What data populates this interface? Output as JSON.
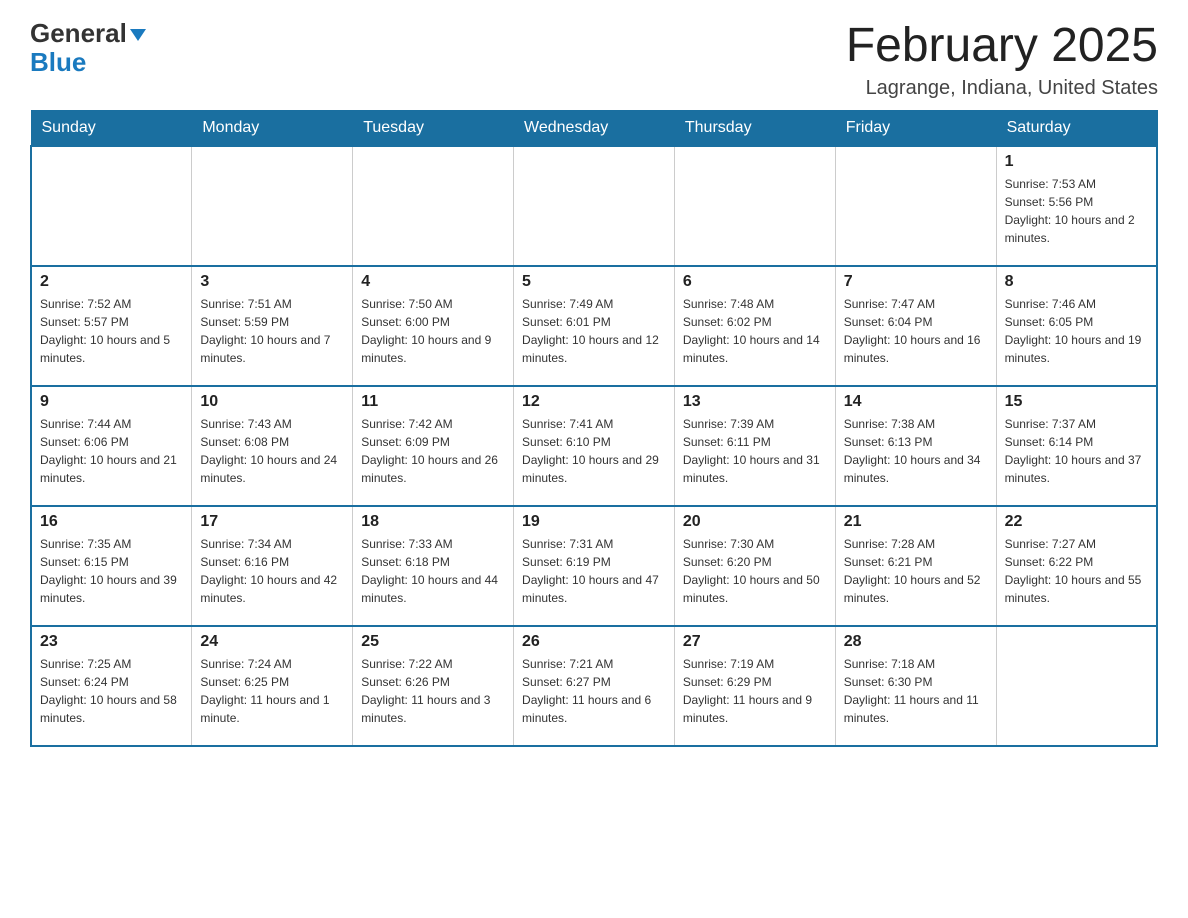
{
  "header": {
    "logo_general": "General",
    "logo_blue": "Blue",
    "month_title": "February 2025",
    "location": "Lagrange, Indiana, United States"
  },
  "days_of_week": [
    "Sunday",
    "Monday",
    "Tuesday",
    "Wednesday",
    "Thursday",
    "Friday",
    "Saturday"
  ],
  "weeks": [
    [
      {
        "day": "",
        "info": ""
      },
      {
        "day": "",
        "info": ""
      },
      {
        "day": "",
        "info": ""
      },
      {
        "day": "",
        "info": ""
      },
      {
        "day": "",
        "info": ""
      },
      {
        "day": "",
        "info": ""
      },
      {
        "day": "1",
        "info": "Sunrise: 7:53 AM\nSunset: 5:56 PM\nDaylight: 10 hours and 2 minutes."
      }
    ],
    [
      {
        "day": "2",
        "info": "Sunrise: 7:52 AM\nSunset: 5:57 PM\nDaylight: 10 hours and 5 minutes."
      },
      {
        "day": "3",
        "info": "Sunrise: 7:51 AM\nSunset: 5:59 PM\nDaylight: 10 hours and 7 minutes."
      },
      {
        "day": "4",
        "info": "Sunrise: 7:50 AM\nSunset: 6:00 PM\nDaylight: 10 hours and 9 minutes."
      },
      {
        "day": "5",
        "info": "Sunrise: 7:49 AM\nSunset: 6:01 PM\nDaylight: 10 hours and 12 minutes."
      },
      {
        "day": "6",
        "info": "Sunrise: 7:48 AM\nSunset: 6:02 PM\nDaylight: 10 hours and 14 minutes."
      },
      {
        "day": "7",
        "info": "Sunrise: 7:47 AM\nSunset: 6:04 PM\nDaylight: 10 hours and 16 minutes."
      },
      {
        "day": "8",
        "info": "Sunrise: 7:46 AM\nSunset: 6:05 PM\nDaylight: 10 hours and 19 minutes."
      }
    ],
    [
      {
        "day": "9",
        "info": "Sunrise: 7:44 AM\nSunset: 6:06 PM\nDaylight: 10 hours and 21 minutes."
      },
      {
        "day": "10",
        "info": "Sunrise: 7:43 AM\nSunset: 6:08 PM\nDaylight: 10 hours and 24 minutes."
      },
      {
        "day": "11",
        "info": "Sunrise: 7:42 AM\nSunset: 6:09 PM\nDaylight: 10 hours and 26 minutes."
      },
      {
        "day": "12",
        "info": "Sunrise: 7:41 AM\nSunset: 6:10 PM\nDaylight: 10 hours and 29 minutes."
      },
      {
        "day": "13",
        "info": "Sunrise: 7:39 AM\nSunset: 6:11 PM\nDaylight: 10 hours and 31 minutes."
      },
      {
        "day": "14",
        "info": "Sunrise: 7:38 AM\nSunset: 6:13 PM\nDaylight: 10 hours and 34 minutes."
      },
      {
        "day": "15",
        "info": "Sunrise: 7:37 AM\nSunset: 6:14 PM\nDaylight: 10 hours and 37 minutes."
      }
    ],
    [
      {
        "day": "16",
        "info": "Sunrise: 7:35 AM\nSunset: 6:15 PM\nDaylight: 10 hours and 39 minutes."
      },
      {
        "day": "17",
        "info": "Sunrise: 7:34 AM\nSunset: 6:16 PM\nDaylight: 10 hours and 42 minutes."
      },
      {
        "day": "18",
        "info": "Sunrise: 7:33 AM\nSunset: 6:18 PM\nDaylight: 10 hours and 44 minutes."
      },
      {
        "day": "19",
        "info": "Sunrise: 7:31 AM\nSunset: 6:19 PM\nDaylight: 10 hours and 47 minutes."
      },
      {
        "day": "20",
        "info": "Sunrise: 7:30 AM\nSunset: 6:20 PM\nDaylight: 10 hours and 50 minutes."
      },
      {
        "day": "21",
        "info": "Sunrise: 7:28 AM\nSunset: 6:21 PM\nDaylight: 10 hours and 52 minutes."
      },
      {
        "day": "22",
        "info": "Sunrise: 7:27 AM\nSunset: 6:22 PM\nDaylight: 10 hours and 55 minutes."
      }
    ],
    [
      {
        "day": "23",
        "info": "Sunrise: 7:25 AM\nSunset: 6:24 PM\nDaylight: 10 hours and 58 minutes."
      },
      {
        "day": "24",
        "info": "Sunrise: 7:24 AM\nSunset: 6:25 PM\nDaylight: 11 hours and 1 minute."
      },
      {
        "day": "25",
        "info": "Sunrise: 7:22 AM\nSunset: 6:26 PM\nDaylight: 11 hours and 3 minutes."
      },
      {
        "day": "26",
        "info": "Sunrise: 7:21 AM\nSunset: 6:27 PM\nDaylight: 11 hours and 6 minutes."
      },
      {
        "day": "27",
        "info": "Sunrise: 7:19 AM\nSunset: 6:29 PM\nDaylight: 11 hours and 9 minutes."
      },
      {
        "day": "28",
        "info": "Sunrise: 7:18 AM\nSunset: 6:30 PM\nDaylight: 11 hours and 11 minutes."
      },
      {
        "day": "",
        "info": ""
      }
    ]
  ]
}
